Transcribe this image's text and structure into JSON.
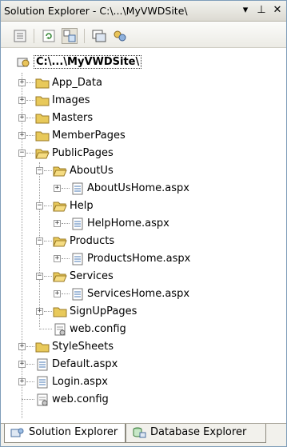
{
  "window": {
    "title": "Solution Explorer - C:\\...\\MyVWDSite\\",
    "dropdown_glyph": "▾",
    "pin_glyph": "⊥",
    "close_glyph": "✕"
  },
  "toolbar": {
    "buttons": [
      "properties-icon",
      "refresh-icon",
      "nest-related-files-icon",
      "view-designer-icon",
      "copy-website-icon"
    ]
  },
  "tree": {
    "root": "C:\\...\\MyVWDSite\\",
    "items": [
      {
        "label": "App_Data",
        "icon": "folder-icon"
      },
      {
        "label": "Images",
        "icon": "folder-icon"
      },
      {
        "label": "Masters",
        "icon": "folder-icon"
      },
      {
        "label": "MemberPages",
        "icon": "folder-icon"
      },
      {
        "label": "PublicPages",
        "icon": "folder-open-icon"
      },
      {
        "label": "AboutUs",
        "icon": "folder-open-icon"
      },
      {
        "label": "AboutUsHome.aspx",
        "icon": "aspx-file-icon"
      },
      {
        "label": "Help",
        "icon": "folder-open-icon"
      },
      {
        "label": "HelpHome.aspx",
        "icon": "aspx-file-icon"
      },
      {
        "label": "Products",
        "icon": "folder-open-icon"
      },
      {
        "label": "ProductsHome.aspx",
        "icon": "aspx-file-icon"
      },
      {
        "label": "Services",
        "icon": "folder-open-icon"
      },
      {
        "label": "ServicesHome.aspx",
        "icon": "aspx-file-icon"
      },
      {
        "label": "SignUpPages",
        "icon": "folder-icon"
      },
      {
        "label": "web.config",
        "icon": "config-file-icon"
      },
      {
        "label": "StyleSheets",
        "icon": "folder-icon"
      },
      {
        "label": "Default.aspx",
        "icon": "aspx-file-icon"
      },
      {
        "label": "Login.aspx",
        "icon": "aspx-file-icon"
      },
      {
        "label": "web.config",
        "icon": "config-file-icon"
      }
    ]
  },
  "tabs": [
    {
      "label": "Solution Explorer",
      "icon": "solution-explorer-icon",
      "active": true
    },
    {
      "label": "Database Explorer",
      "icon": "database-explorer-icon",
      "active": false
    }
  ],
  "colors": {
    "folder": "#e8c95a",
    "window_border": "#7f9db9"
  }
}
